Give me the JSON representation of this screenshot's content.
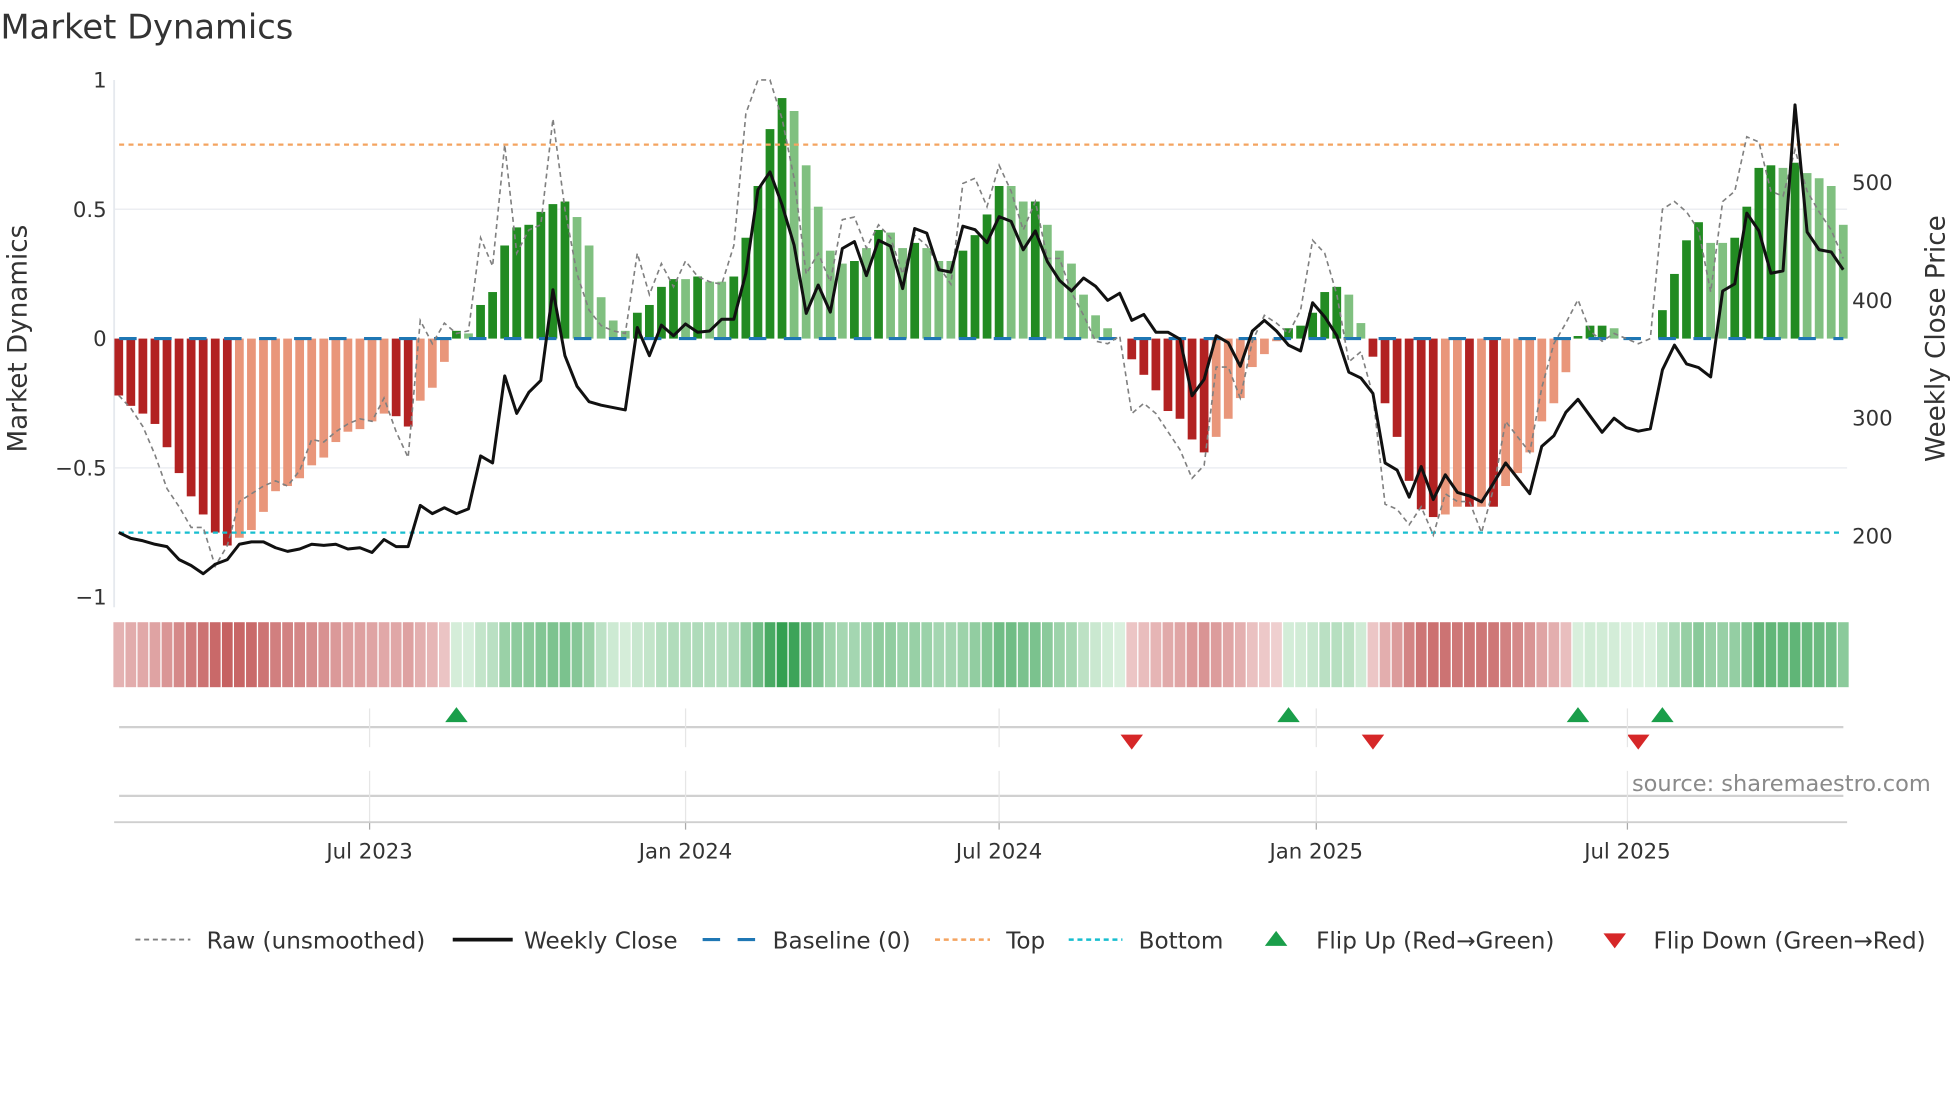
{
  "chart_data": {
    "type": "bar",
    "title": "Market Dynamics",
    "ylabel": "Market Dynamics",
    "y2label": "Weekly Close Price",
    "ylim": [
      -1,
      1
    ],
    "y2lim": [
      150,
      590
    ],
    "yticks": [
      "1",
      "0.5",
      "0",
      "−0.5",
      "−1"
    ],
    "ytick_values": [
      1,
      0.5,
      0,
      -0.5,
      -1
    ],
    "y2ticks": [
      "500",
      "400",
      "300",
      "200"
    ],
    "y2tick_values": [
      500,
      400,
      300,
      200
    ],
    "x_unit": "week index",
    "xticks": [
      {
        "label": "Jul 2023",
        "at": 20.8
      },
      {
        "label": "Jan 2024",
        "at": 47.0
      },
      {
        "label": "Jul 2024",
        "at": 73.0
      },
      {
        "label": "Jan 2025",
        "at": 99.3
      },
      {
        "label": "Jul 2025",
        "at": 125.1
      }
    ],
    "levels": {
      "baseline": 0,
      "top": 0.75,
      "bottom": -0.75
    },
    "values": [
      -0.22,
      -0.26,
      -0.29,
      -0.33,
      -0.42,
      -0.52,
      -0.61,
      -0.68,
      -0.75,
      -0.8,
      -0.77,
      -0.74,
      -0.67,
      -0.59,
      -0.57,
      -0.54,
      -0.49,
      -0.46,
      -0.4,
      -0.36,
      -0.35,
      -0.32,
      -0.29,
      -0.3,
      -0.34,
      -0.24,
      -0.19,
      -0.09,
      0.03,
      0.02,
      0.13,
      0.18,
      0.36,
      0.43,
      0.44,
      0.49,
      0.52,
      0.53,
      0.47,
      0.36,
      0.16,
      0.07,
      0.03,
      0.1,
      0.13,
      0.2,
      0.23,
      0.23,
      0.24,
      0.22,
      0.22,
      0.24,
      0.39,
      0.59,
      0.81,
      0.93,
      0.88,
      0.67,
      0.51,
      0.34,
      0.29,
      0.3,
      0.35,
      0.42,
      0.41,
      0.35,
      0.37,
      0.35,
      0.3,
      0.3,
      0.34,
      0.4,
      0.48,
      0.59,
      0.59,
      0.53,
      0.53,
      0.44,
      0.34,
      0.29,
      0.17,
      0.09,
      0.04,
      0.0,
      -0.08,
      -0.14,
      -0.2,
      -0.28,
      -0.31,
      -0.39,
      -0.44,
      -0.38,
      -0.31,
      -0.23,
      -0.11,
      -0.06,
      -0.01,
      0.04,
      0.05,
      0.1,
      0.18,
      0.2,
      0.17,
      0.06,
      -0.07,
      -0.25,
      -0.38,
      -0.55,
      -0.66,
      -0.69,
      -0.68,
      -0.65,
      -0.65,
      -0.65,
      -0.65,
      -0.57,
      -0.52,
      -0.44,
      -0.32,
      -0.25,
      -0.13,
      0.01,
      0.05,
      0.05,
      0.04,
      0,
      0,
      0,
      0.11,
      0.25,
      0.38,
      0.45,
      0.37,
      0.37,
      0.39,
      0.51,
      0.66,
      0.67,
      0.66,
      0.68,
      0.64,
      0.62,
      0.59,
      0.44
    ],
    "shades": "DDDDDDDDDDLLLLLLLLLLLLLDDLLLDLDDDDDDDDLLLLLDDDDLDLLDDDDDLLLLLDLDLLDLLLDDDDLLDLLLLLLLDDDDDDDLLLLLLDDDDDLLDDDDDDLLDLDLLLLLLDDDLLLLDDDDLLDDDDLDLLLL",
    "raw": [
      -0.22,
      -0.27,
      -0.34,
      -0.45,
      -0.58,
      -0.65,
      -0.73,
      -0.73,
      -0.88,
      -0.8,
      -0.63,
      -0.6,
      -0.57,
      -0.55,
      -0.57,
      -0.51,
      -0.39,
      -0.4,
      -0.36,
      -0.33,
      -0.31,
      -0.32,
      -0.23,
      -0.36,
      -0.46,
      0.07,
      -0.02,
      0.06,
      0.02,
      0.03,
      0.39,
      0.28,
      0.75,
      0.33,
      0.42,
      0.44,
      0.85,
      0.5,
      0.25,
      0.11,
      0.05,
      0.03,
      0.02,
      0.33,
      0.17,
      0.29,
      0.2,
      0.3,
      0.24,
      0.22,
      0.21,
      0.36,
      0.87,
      1.0,
      1.0,
      0.85,
      0.62,
      0.25,
      0.33,
      0.22,
      0.46,
      0.47,
      0.35,
      0.44,
      0.39,
      0.25,
      0.4,
      0.36,
      0.28,
      0.21,
      0.6,
      0.62,
      0.51,
      0.67,
      0.57,
      0.42,
      0.53,
      0.31,
      0.31,
      0.18,
      0.09,
      -0.01,
      -0.02,
      0.01,
      -0.29,
      -0.25,
      -0.29,
      -0.36,
      -0.43,
      -0.54,
      -0.49,
      -0.11,
      -0.11,
      -0.23,
      -0.01,
      0.09,
      0.06,
      0.02,
      0.11,
      0.38,
      0.33,
      0.17,
      -0.09,
      -0.05,
      -0.22,
      -0.64,
      -0.66,
      -0.72,
      -0.65,
      -0.76,
      -0.6,
      -0.63,
      -0.63,
      -0.75,
      -0.58,
      -0.32,
      -0.38,
      -0.44,
      -0.19,
      -0.02,
      0.06,
      0.15,
      0.03,
      -0.01,
      0.02,
      0,
      -0.02,
      0,
      0.5,
      0.53,
      0.49,
      0.42,
      0.18,
      0.53,
      0.57,
      0.78,
      0.76,
      0.57,
      0.55,
      0.73,
      0.57,
      0.49,
      0.42,
      0.31
    ],
    "close": [
      203,
      198,
      196,
      193,
      191,
      180,
      175,
      168,
      176,
      180,
      193,
      195,
      195,
      190,
      187,
      189,
      193,
      192,
      193,
      189,
      190,
      186,
      197,
      191,
      191,
      226,
      219,
      224,
      219,
      223,
      268,
      262,
      336,
      304,
      322,
      332,
      409,
      353,
      327,
      314,
      311,
      309,
      307,
      377,
      353,
      379,
      370,
      380,
      373,
      374,
      384,
      384,
      423,
      494,
      509,
      481,
      447,
      389,
      413,
      390,
      444,
      450,
      421,
      451,
      446,
      410,
      461,
      457,
      426,
      424,
      463,
      460,
      449,
      471,
      467,
      443,
      459,
      433,
      417,
      408,
      419,
      412,
      400,
      406,
      383,
      388,
      373,
      373,
      367,
      319,
      333,
      370,
      364,
      344,
      374,
      383,
      374,
      362,
      357,
      398,
      386,
      370,
      339,
      334,
      321,
      262,
      256,
      233,
      259,
      231,
      252,
      237,
      234,
      229,
      245,
      262,
      249,
      236,
      276,
      285,
      305,
      316,
      302,
      288,
      300,
      292,
      289,
      291,
      341,
      362,
      346,
      343,
      335,
      408,
      414,
      474,
      459,
      423,
      425,
      566,
      458,
      443,
      441,
      426
    ],
    "flip_up": [
      28,
      97,
      121,
      128
    ],
    "flip_down": [
      84,
      104,
      126
    ],
    "legend": {
      "placement": "bottom",
      "items": [
        "Raw (unsmoothed)",
        "Weekly Close",
        "Baseline (0)",
        "Top",
        "Bottom",
        "Flip Up (Red→Green)",
        "Flip Down (Green→Red)"
      ]
    },
    "colors": {
      "dark_red": "#b22222",
      "light_red": "#e9967a",
      "dark_green": "#228b22",
      "light_green": "#80c080",
      "raw": "#808080",
      "close": "#111111",
      "baseline": "#1f77b4",
      "top": "#f4a460",
      "bottom": "#17becf",
      "flip_up": "#1a9e4a",
      "flip_down": "#d62728"
    }
  },
  "source": "source: sharemaestro.com"
}
